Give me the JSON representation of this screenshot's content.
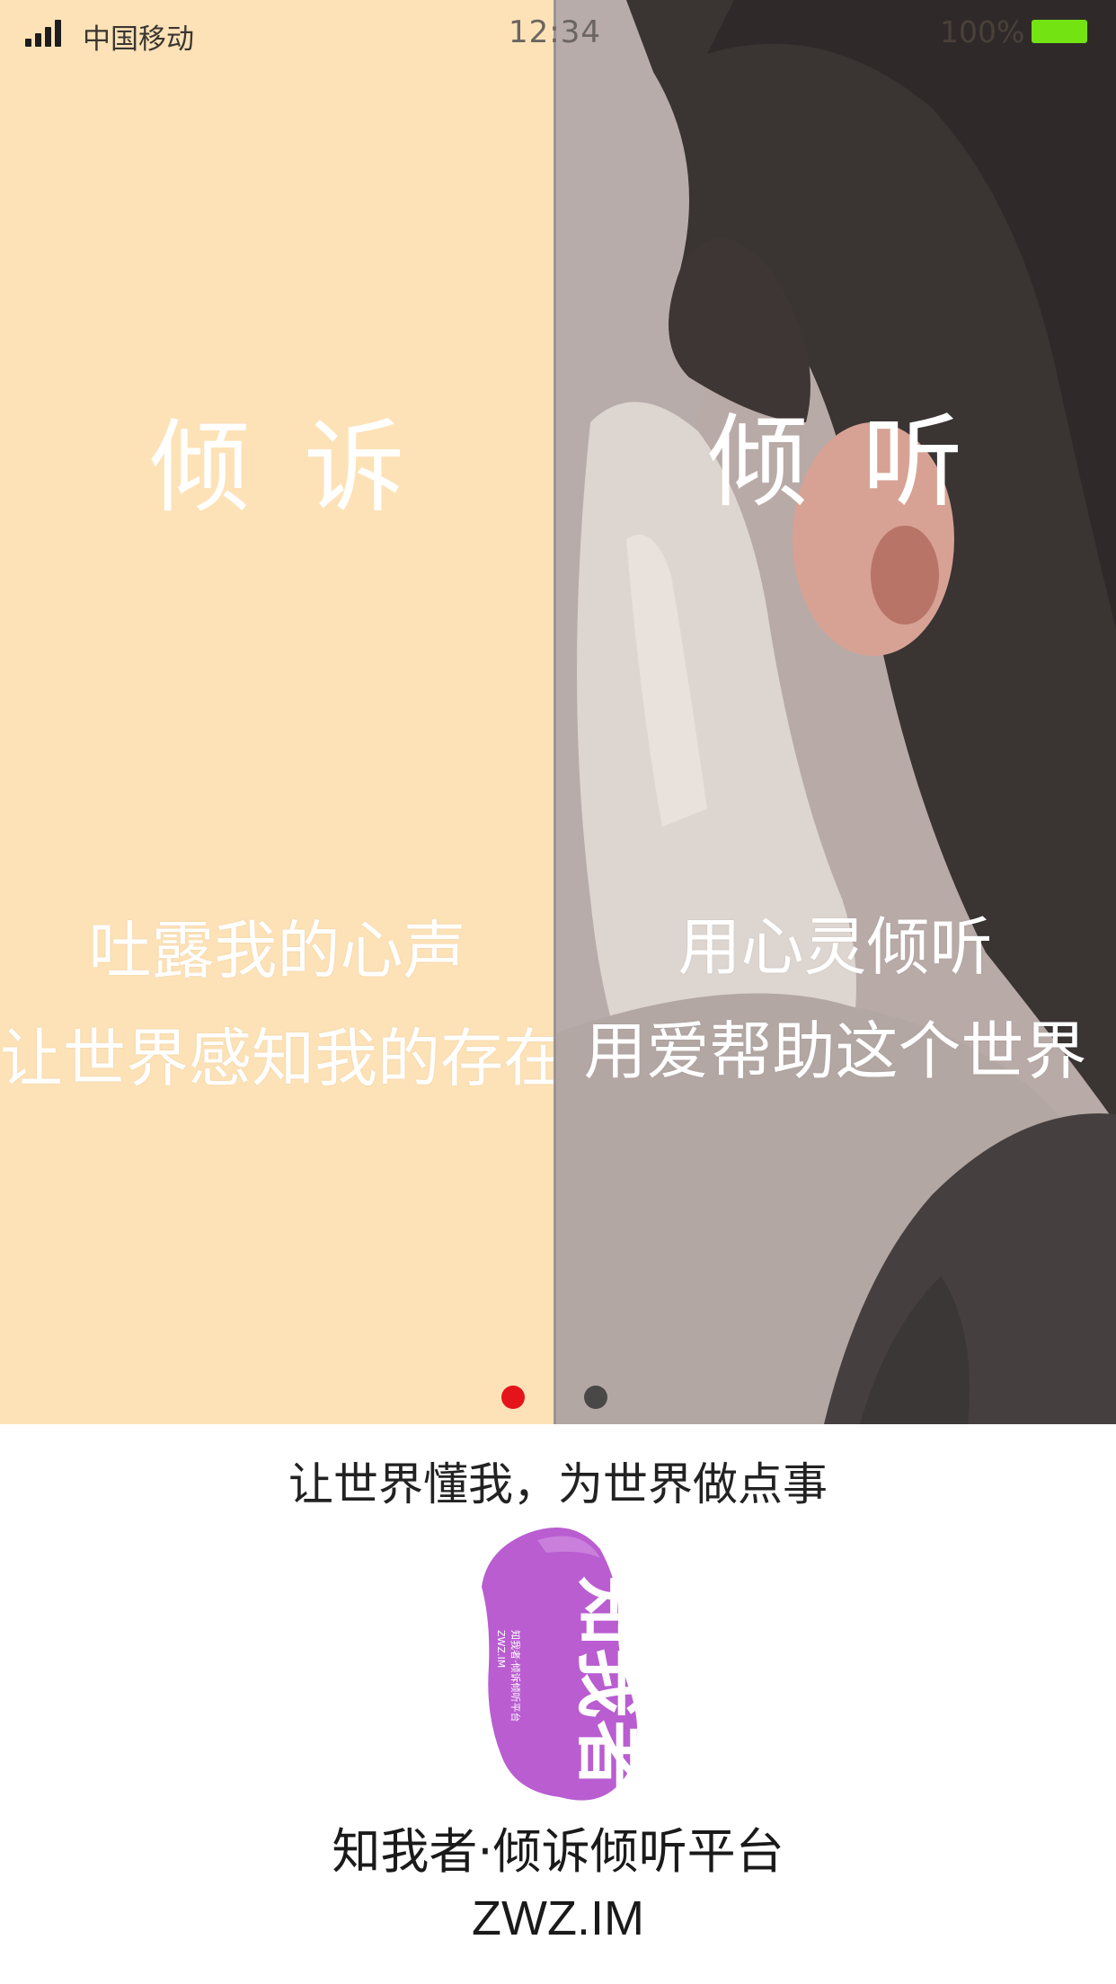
{
  "status_bar": {
    "carrier": "中国移动",
    "time": "12:34",
    "battery": "100%",
    "battery_color": "#74e312"
  },
  "panels": {
    "left": {
      "title": "倾诉",
      "line1": "吐露我的心声",
      "line2": "让世界感知我的存在",
      "background": "#fde2b7"
    },
    "right": {
      "title": "倾听",
      "line1": "用心灵倾听",
      "line2": "用爱帮助这个世界"
    }
  },
  "pager": {
    "count": 2,
    "active_index": 0,
    "active_color": "#e5141a",
    "inactive_color": "#4a4747"
  },
  "footer": {
    "slogan": "让世界懂我，为世界做点事",
    "logo_text": "知我者",
    "logo_small_text": "知我者·倾诉倾听平台",
    "logo_domain_text": "ZWZ.IM",
    "logo_color": "#b95dd1",
    "app_name": "知我者·倾诉倾听平台",
    "domain": "ZWZ.IM"
  }
}
